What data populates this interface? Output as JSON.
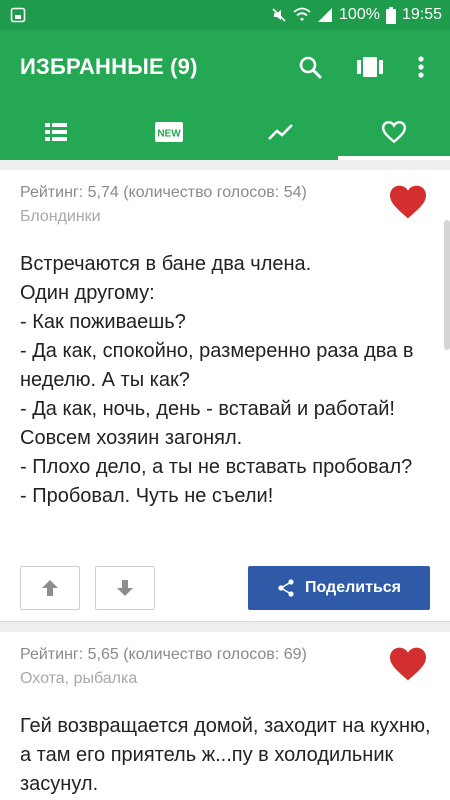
{
  "status_bar": {
    "battery": "100%",
    "time": "19:55",
    "icons": [
      "sim-icon",
      "mute-icon",
      "wifi-icon",
      "signal-icon",
      "battery-icon"
    ]
  },
  "app_bar": {
    "title": "ИЗБРАННЫЕ (9)",
    "actions": [
      "search-icon",
      "carousel-icon",
      "more-vert-icon"
    ]
  },
  "tabs": [
    {
      "icon": "list-icon",
      "selected": false
    },
    {
      "icon": "new-icon",
      "label": "NEW",
      "selected": false
    },
    {
      "icon": "trending-icon",
      "selected": false
    },
    {
      "icon": "heart-outline-icon",
      "selected": true
    }
  ],
  "cards": [
    {
      "rating": "Рейтинг: 5,74 (количество голосов: 54)",
      "category": "Блондинки",
      "favorite": true,
      "text": "Встречаются в бане два члена.\nОдин другому:\n- Как поживаешь?\n- Да как, спокойно, размеренно раза два в неделю. А ты как?\n- Да как, ночь, день - вставай и работай! Совсем хозяин загонял.\n- Плохо дело, а ты не вставать пробовал?\n- Пробовал. Чуть не съели!",
      "share_label": "Поделиться"
    },
    {
      "rating": "Рейтинг: 5,65 (количество голосов: 69)",
      "category": "Охота, рыбалка",
      "favorite": true,
      "text": "Гей возвращается домой, заходит на кухню, а там его приятель ж...пу в холодильник засунул.\n- Ты что делаешь?"
    }
  ],
  "colors": {
    "status_bar": "#1e9c4b",
    "app_bar": "#24a853",
    "share_button": "#2f5aa8",
    "heart": "#d32f2f"
  }
}
